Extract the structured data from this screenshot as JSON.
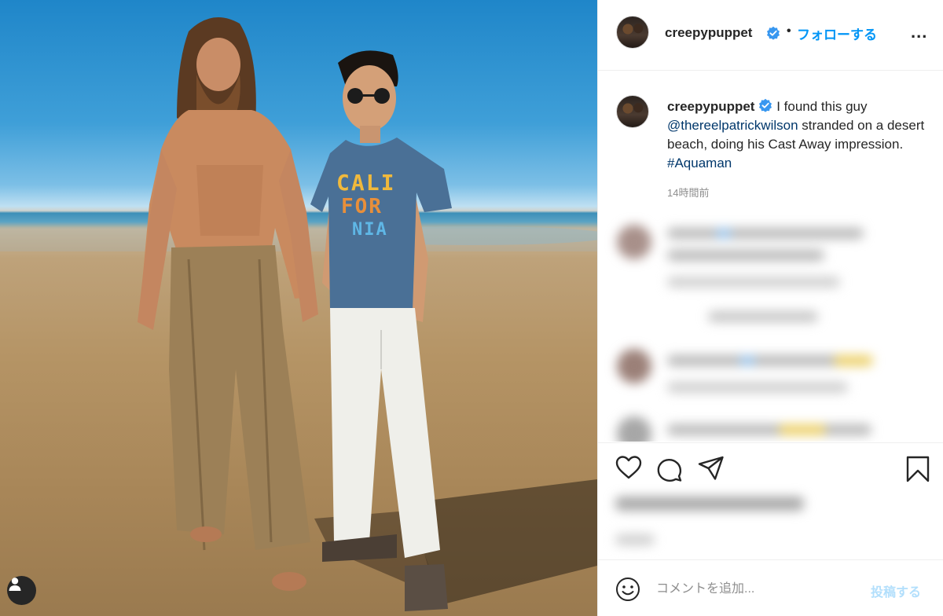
{
  "photo": {
    "shirt_text": [
      "CALI",
      "FOR",
      "NIA"
    ],
    "user_tag_icon": "person-icon"
  },
  "post": {
    "username": "creepypuppet",
    "verified_icon": "verified-badge-icon",
    "separator": "•",
    "follow_label": "フォローする",
    "more_label": "...",
    "caption": {
      "username": "creepypuppet",
      "text_1": "I found this guy",
      "mention": "@thereelpatrickwilson",
      "text_2": "stranded on a desert beach, doing his Cast Away impression.",
      "hashtag": "#Aquaman"
    },
    "timestamp": "14時間前"
  },
  "actions": {
    "icons": [
      "heart-icon",
      "comment-icon",
      "share-icon",
      "bookmark-icon"
    ]
  },
  "comment_box": {
    "emoji_icon": "emoji-icon",
    "placeholder": "コメントを追加...",
    "post_label": "投稿する"
  },
  "colors": {
    "accent": "#0095f6",
    "link": "#00376b",
    "muted": "#8e8e8e",
    "post_disabled": "#b2dffc",
    "border": "#efefef"
  }
}
